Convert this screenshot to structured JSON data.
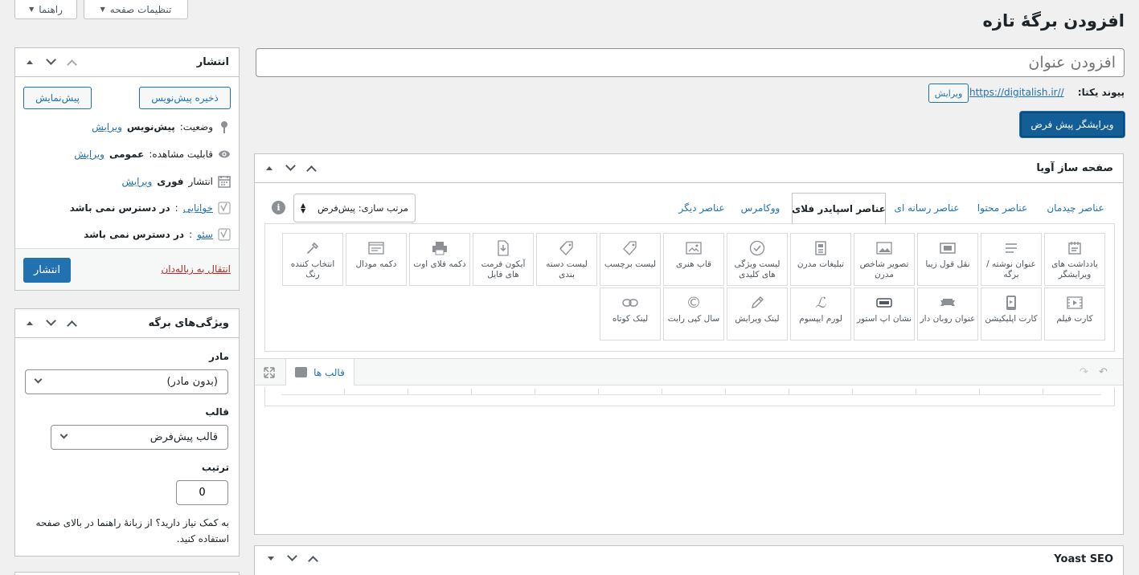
{
  "top_buttons": {
    "help": "راهنما",
    "screen_options": "تنظیمات صفحه"
  },
  "page_title": "افزودن برگهٔ تازه",
  "title_input": {
    "placeholder": "افزودن عنوان"
  },
  "permalink": {
    "label": "پیوند یکتا:",
    "url": "https://digitalish.ir//",
    "edit": "ویرایش"
  },
  "default_editor_button": "ویرایشگر پیش فرض",
  "builder": {
    "title": "صفحه ساز آویا",
    "tabs": [
      "عناصر چیدمان",
      "عناصر محتوا",
      "عناصر رسانه ای",
      "عناصر اسپایدر فلای",
      "ووکامرس",
      "عناصر دیگر"
    ],
    "active_tab": "عناصر اسپایدر فلای",
    "sort_label": "مرتب سازی: پیش‌فرض",
    "elements_row1": [
      "یادداشت های ویرایشگر",
      "عنوان نوشته / برگه",
      "نقل قول زیبا",
      "تصویر شاخص مدرن",
      "تبلیغات مدرن",
      "لیست ویژگی های کلیدی",
      "قاب هنری",
      "لیست برچسب",
      "لیست دسته بندی",
      "آیکون فرمت های فایل",
      "دکمه فلای اوت",
      "دکمه مودال",
      "انتخاب کننده رنگ"
    ],
    "elements_row2": [
      "کارت فیلم",
      "کارت اپلیکیشن",
      "عنوان روبان دار",
      "نشان اپ استور",
      "لورم ایپسوم",
      "لینک ویرایش",
      "سال کپی رایت",
      "لینک کوتاه"
    ],
    "templates_label": "قالب ها"
  },
  "yoast": {
    "title": "Yoast SEO"
  },
  "publish": {
    "title": "انتشار",
    "save_draft": "ذخیره پیش‌نویس",
    "preview": "پیش‌نمایش",
    "status_label": "وضعیت:",
    "status_value": "پیش‌نویس",
    "visibility_label": "قابلیت مشاهده:",
    "visibility_value": "عمومی",
    "publish_time_label": "انتشار",
    "publish_time_value": "فوری",
    "edit": "ویرایش",
    "readability_label": "خوانایی",
    "readability_value": "در دسترس نمی باشد",
    "seo_label": "سئو",
    "seo_value": "در دسترس نمی باشد",
    "trash": "انتقال به زباله‌دان",
    "publish_button": "انتشار"
  },
  "attributes": {
    "title": "ویژگی‌های برگه",
    "parent_label": "مادر",
    "parent_value": "(بدون مادر)",
    "template_label": "قالب",
    "template_value": "قالب پیش‌فرض",
    "order_label": "ترتیب",
    "order_value": "0",
    "help_text": "به کمک نیاز دارید؟ از زبانهٔ راهنما در بالای صفحه استفاده کنید."
  },
  "colors": {
    "primary": "#2271b1",
    "dark_primary": "#135e96",
    "trash": "#b32d2e"
  }
}
